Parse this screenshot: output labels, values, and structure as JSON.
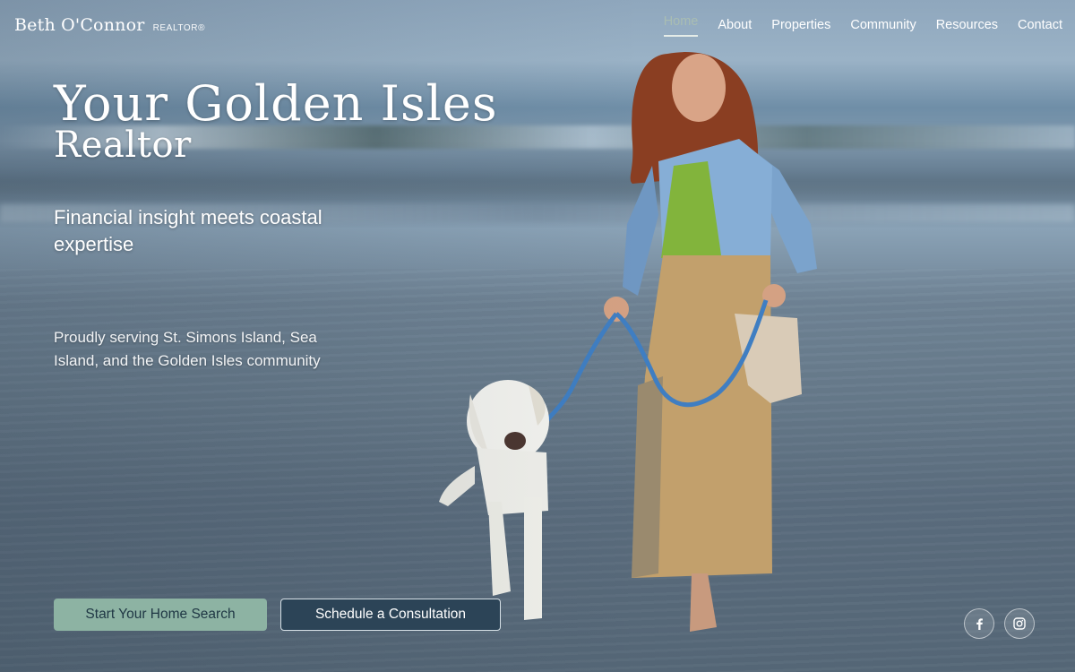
{
  "header": {
    "logo_name": "Beth O'Connor",
    "logo_tag": "REALTOR®",
    "nav": [
      {
        "label": "Home",
        "active": true
      },
      {
        "label": "About"
      },
      {
        "label": "Properties"
      },
      {
        "label": "Community"
      },
      {
        "label": "Resources"
      },
      {
        "label": "Contact"
      }
    ]
  },
  "hero": {
    "headline_line1": "Your Golden Isles",
    "headline_line2": "Realtor",
    "tagline": "Financial insight meets coastal expertise",
    "serving_text": "Proudly serving St. Simons Island, Sea Island, and the Golden Isles community",
    "background_image": "woman-walking-dog-on-beach",
    "primary_button": "Start Your Home Search",
    "secondary_button": "Schedule a Consultation"
  },
  "social": [
    {
      "name": "facebook",
      "icon": "facebook-icon"
    },
    {
      "name": "instagram",
      "icon": "instagram-icon"
    }
  ],
  "colors": {
    "accent_green": "#8db3a3",
    "navy": "#2c4457",
    "nav_active": "#a9bdb2"
  }
}
